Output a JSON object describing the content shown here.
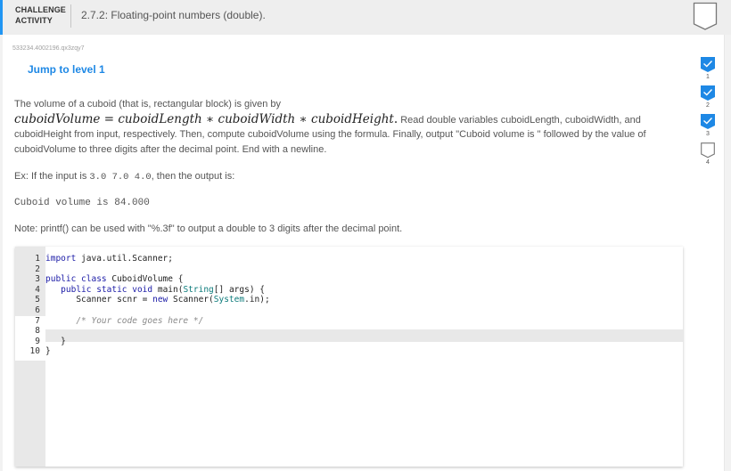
{
  "header": {
    "label_line1": "CHALLENGE",
    "label_line2": "ACTIVITY",
    "title": "2.7.2: Floating-point numbers (double).",
    "badge_icon": "incomplete-badge-icon"
  },
  "activity_id": "533234.4002196.qx3zqy7",
  "jump_link": "Jump to level 1",
  "prompt": {
    "intro": "The volume of a cuboid (that is, rectangular block) is given by",
    "formula_lhs": "cuboidVolume",
    "formula_eq": "=",
    "formula_t1": "cuboidLength",
    "formula_op": "∗",
    "formula_t2": "cuboidWidth",
    "formula_t3": "cuboidHeight",
    "formula_end": ".",
    "text1": " Read double variables cuboidLength, cuboidWidth, and cuboidHeight from input, respectively. Then, compute cuboidVolume using the formula. Finally, output \"Cuboid volume is \" followed by the value of cuboidVolume to three digits after the decimal point. End with a newline."
  },
  "example": {
    "prefix": "Ex: If the input is ",
    "input": "3.0 7.0 4.0",
    "suffix": ", then the output is:",
    "output": "Cuboid volume is 84.000"
  },
  "note": "Note: printf() can be used with \"%.3f\" to output a double to 3 digits after the decimal point.",
  "editor": {
    "line_numbers": [
      "1",
      "2",
      "3",
      "4",
      "5",
      "6",
      "7",
      "8",
      "9",
      "10"
    ],
    "lines": [
      [
        {
          "t": "kw",
          "v": "import"
        },
        {
          "t": "",
          "v": " java.util.Scanner;"
        }
      ],
      [],
      [
        {
          "t": "kw",
          "v": "public class"
        },
        {
          "t": "",
          "v": " CuboidVolume {"
        }
      ],
      [
        {
          "t": "",
          "v": "   "
        },
        {
          "t": "kw",
          "v": "public static void"
        },
        {
          "t": "",
          "v": " main("
        },
        {
          "t": "ty",
          "v": "String"
        },
        {
          "t": "",
          "v": "[] args) {"
        }
      ],
      [
        {
          "t": "",
          "v": "      Scanner scnr = "
        },
        {
          "t": "kw",
          "v": "new"
        },
        {
          "t": "",
          "v": " Scanner("
        },
        {
          "t": "ty",
          "v": "System"
        },
        {
          "t": "",
          "v": ".in);"
        }
      ],
      [],
      [
        {
          "t": "",
          "v": "      "
        },
        {
          "t": "cm",
          "v": "/* Your code goes here */"
        }
      ],
      [],
      [
        {
          "t": "",
          "v": "   }"
        }
      ],
      [
        {
          "t": "",
          "v": "}"
        }
      ]
    ]
  },
  "levels": [
    {
      "num": "1",
      "status": "complete",
      "icon": "check-badge-icon"
    },
    {
      "num": "2",
      "status": "complete",
      "icon": "check-badge-icon"
    },
    {
      "num": "3",
      "status": "complete",
      "icon": "check-badge-icon"
    },
    {
      "num": "4",
      "status": "incomplete",
      "icon": "empty-badge-icon"
    }
  ],
  "colors": {
    "accent": "#2196f3",
    "link": "#1e88e5",
    "badge_complete": "#1e88e5"
  }
}
